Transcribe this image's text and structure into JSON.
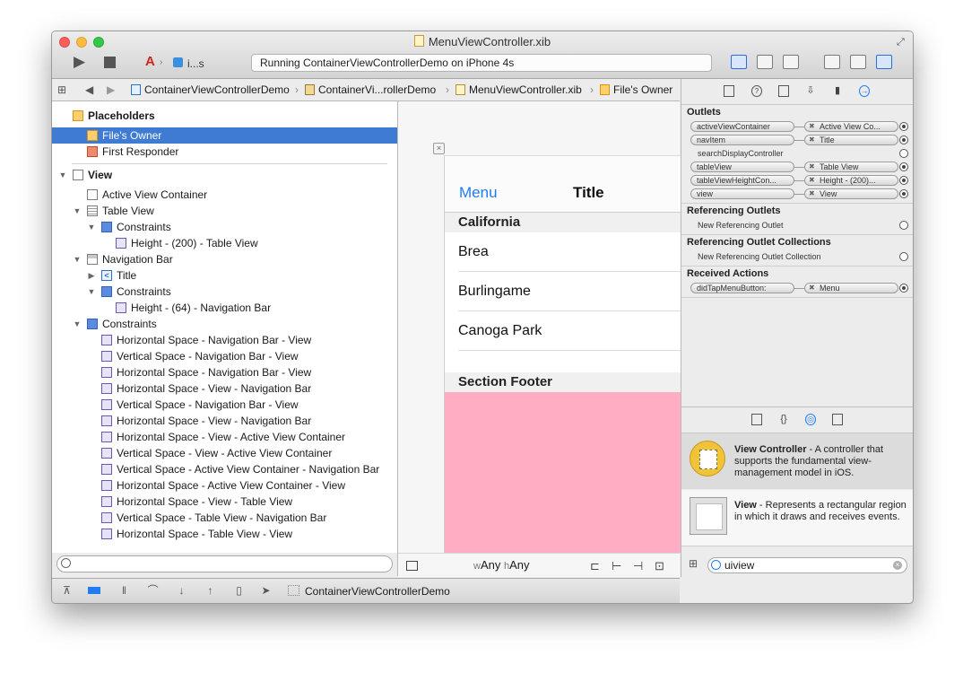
{
  "window": {
    "title": "MenuViewController.xib",
    "scheme_target": "i...s",
    "status": "Running ContainerViewControllerDemo on iPhone 4s"
  },
  "breadcrumb": [
    "ContainerViewControllerDemo",
    "ContainerVi...rollerDemo",
    "MenuViewController.xib",
    "File's Owner"
  ],
  "outline": {
    "placeholders_label": "Placeholders",
    "files_owner": "File's Owner",
    "first_responder": "First Responder",
    "view": "View",
    "active_view_container": "Active View Container",
    "table_view": "Table View",
    "constraints": "Constraints",
    "height_table": "Height - (200) - Table View",
    "navigation_bar": "Navigation Bar",
    "title": "Title",
    "height_nav": "Height - (64) - Navigation Bar",
    "constraint_items": [
      "Horizontal Space - Navigation Bar - View",
      "Vertical Space - Navigation Bar - View",
      "Horizontal Space - Navigation Bar - View",
      "Horizontal Space - View - Navigation Bar",
      "Vertical Space - Navigation Bar - View",
      "Horizontal Space - View - Navigation Bar",
      "Horizontal Space - View - Active View Container",
      "Vertical Space - View - Active View Container",
      "Vertical Space - Active View Container - Navigation Bar",
      "Horizontal Space - Active View Container - View",
      "Horizontal Space - View - Table View",
      "Vertical Space - Table View - Navigation Bar",
      "Horizontal Space - Table View - View"
    ]
  },
  "canvas": {
    "nav_left": "Menu",
    "nav_title": "Title",
    "section_header": "California",
    "cells": [
      "Brea",
      "Burlingame",
      "Canoga Park"
    ],
    "section_footer": "Section Footer",
    "size_w_prefix": "w",
    "size_w": "Any",
    "size_h_prefix": "h",
    "size_h": "Any"
  },
  "bottombar": {
    "scheme": "ContainerViewControllerDemo"
  },
  "inspector": {
    "outlets_header": "Outlets",
    "outlets": [
      {
        "name": "activeViewContainer",
        "target": "Active View Co...",
        "connected": true
      },
      {
        "name": "navItem",
        "target": "Title",
        "connected": true
      },
      {
        "name": "searchDisplayController",
        "target": "",
        "connected": false
      },
      {
        "name": "tableView",
        "target": "Table View",
        "connected": true
      },
      {
        "name": "tableViewHeightCon...",
        "target": "Height - (200)...",
        "connected": true
      },
      {
        "name": "view",
        "target": "View",
        "connected": true
      }
    ],
    "ref_outlets_header": "Referencing Outlets",
    "new_ref_outlet": "New Referencing Outlet",
    "ref_collections_header": "Referencing Outlet Collections",
    "new_ref_collection": "New Referencing Outlet Collection",
    "received_actions_header": "Received Actions",
    "action": {
      "name": "didTapMenuButton:",
      "target": "Menu"
    }
  },
  "library": {
    "vc_title": "View Controller",
    "vc_desc": " - A controller that supports the fundamental view-management model in iOS.",
    "view_title": "View",
    "view_desc": " - Represents a rectangular region in which it draws and receives events.",
    "search_value": "uiview"
  }
}
